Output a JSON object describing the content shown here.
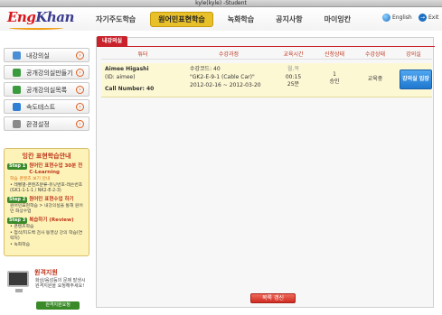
{
  "window": {
    "title": "kyle(kyle) -Student"
  },
  "logo": {
    "text_main": "Eng",
    "text_accent": "Khan"
  },
  "nav": {
    "items": [
      {
        "label": "자기주도학습"
      },
      {
        "label": "원어민표현학습"
      },
      {
        "label": "녹화학습"
      },
      {
        "label": "공지사항"
      },
      {
        "label": "마이잉칸"
      }
    ]
  },
  "header": {
    "lang_label": "English",
    "exit_label": "Exit"
  },
  "sidebar": {
    "items": [
      {
        "label": "내강의실",
        "icon": "classroom-icon",
        "color": "#4a8fd6"
      },
      {
        "label": "공개강의실만들기",
        "icon": "create-room-icon",
        "color": "#3a9b3e"
      },
      {
        "label": "공개강의실목록",
        "icon": "room-list-icon",
        "color": "#3a9b3e"
      },
      {
        "label": "속도테스트",
        "icon": "speed-test-icon",
        "color": "#2f7fd4"
      },
      {
        "label": "환경설정",
        "icon": "settings-icon",
        "color": "#8a8a8a"
      }
    ]
  },
  "guide": {
    "title": "잉칸 표현학습안내",
    "step1_badge": "Step 1",
    "step1_title": "원어민 표현수업 30분 전 C-Learning",
    "step1_sub": "학습 콘텐츠 보기 안내",
    "step1_text": "• 레벨별-콘텐츠분류-유닛번호-레슨번호 (GK1-1-1-1 / NK2-E-2-3)",
    "step2_badge": "Step 2",
    "step2_title": "원어민 표현수업 하기",
    "step2_text": "원어민표현학습 > 내강의실을 통해 원어민 화상수업",
    "step3_badge": "Step 3",
    "step3_title": "복습하기 (Review)",
    "step3_text1": "• 콘텐츠학습",
    "step3_text2": "• 첨삭/피드백 검사 동영상 강의 학습(연락처)",
    "step3_text3": "• 녹화학습"
  },
  "remote": {
    "title": "원격지원",
    "text": "화상/음성등의 문제 발생시 원격지원을 요청해주세요!",
    "button": "원격지원요청"
  },
  "main": {
    "tab_label": "내강의실",
    "columns": [
      "튜터",
      "수강과정",
      "교육시간",
      "신청상태",
      "수강상태",
      "강의실"
    ],
    "row": {
      "tutor_name": "Aimee Higashi",
      "tutor_id": "(ID: aimee)",
      "call_number": "Call Number: 40",
      "course_code": "수강코드:   40",
      "course_name": "\"GK2-E-9-1 (Cable Car)\"",
      "course_period": "2012-02-16 ~ 2012-03-20",
      "time_day": "월,목",
      "time_clock": "00:15",
      "time_minutes": "25분",
      "apply_count": "1",
      "apply_status": "승인",
      "study_status": "교육중",
      "enter_button": "강의실 입장"
    },
    "refresh_button": "목록 갱신"
  }
}
